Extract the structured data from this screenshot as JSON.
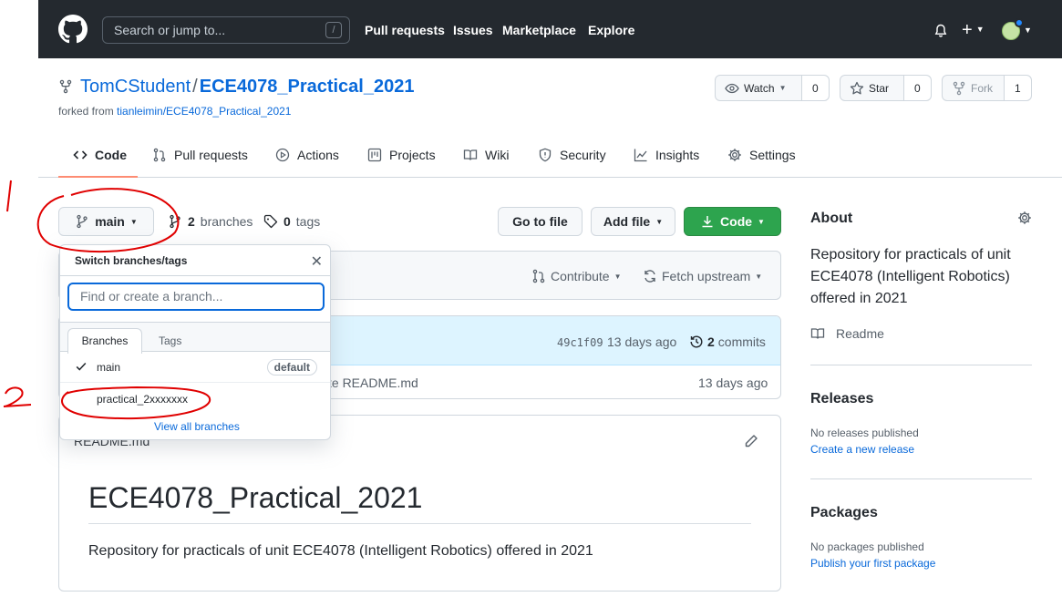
{
  "header": {
    "search_placeholder": "Search or jump to...",
    "slash_key": "/",
    "nav": [
      "Pull requests",
      "Issues",
      "Marketplace",
      "Explore"
    ],
    "plus": "+"
  },
  "repo": {
    "owner": "TomCStudent",
    "separator": "/",
    "name": "ECE4078_Practical_2021",
    "forked_prefix": "forked from",
    "forked_from": "tianleimin/ECE4078_Practical_2021",
    "watch": {
      "label": "Watch",
      "count": "0"
    },
    "star": {
      "label": "Star",
      "count": "0"
    },
    "fork": {
      "label": "Fork",
      "count": "1"
    }
  },
  "tabs": [
    {
      "label": "Code",
      "icon": "code-icon"
    },
    {
      "label": "Pull requests",
      "icon": "pull-request-icon"
    },
    {
      "label": "Actions",
      "icon": "play-icon"
    },
    {
      "label": "Projects",
      "icon": "project-icon"
    },
    {
      "label": "Wiki",
      "icon": "book-icon"
    },
    {
      "label": "Security",
      "icon": "shield-icon"
    },
    {
      "label": "Insights",
      "icon": "graph-icon"
    },
    {
      "label": "Settings",
      "icon": "gear-icon"
    }
  ],
  "branchbar": {
    "branch": "main",
    "branches_count": "2",
    "branches_label": "branches",
    "tags_count": "0",
    "tags_label": "tags",
    "go_to_file": "Go to file",
    "add_file": "Add file",
    "code": "Code"
  },
  "fork_bar": {
    "contribute": "Contribute",
    "fetch_upstream": "Fetch upstream"
  },
  "commit": {
    "hash": "49c1f09",
    "time": "13 days ago",
    "commits_count": "2",
    "commits_label": "commits",
    "file_msg": "te README.md",
    "file_time": "13 days ago"
  },
  "dropdown": {
    "title": "Switch branches/tags",
    "placeholder": "Find or create a branch...",
    "tab_branches": "Branches",
    "tab_tags": "Tags",
    "branches": [
      {
        "name": "main",
        "badge": "default"
      },
      {
        "name": "practical_2xxxxxxx"
      }
    ],
    "view_all": "View all branches"
  },
  "readme": {
    "file_label": "README.md",
    "heading": "ECE4078_Practical_2021",
    "body": "Repository for practicals of unit ECE4078 (Intelligent Robotics) offered in 2021"
  },
  "sidebar": {
    "about_title": "About",
    "about_text": "Repository for practicals of unit ECE4078 (Intelligent Robotics) offered in 2021",
    "readme_link": "Readme",
    "releases_title": "Releases",
    "releases_text": "No releases published",
    "releases_link": "Create a new release",
    "packages_title": "Packages",
    "packages_text": "No packages published",
    "packages_link": "Publish your first package"
  },
  "annotations": {
    "one": "1",
    "two": "2",
    "color": "#e00000"
  }
}
